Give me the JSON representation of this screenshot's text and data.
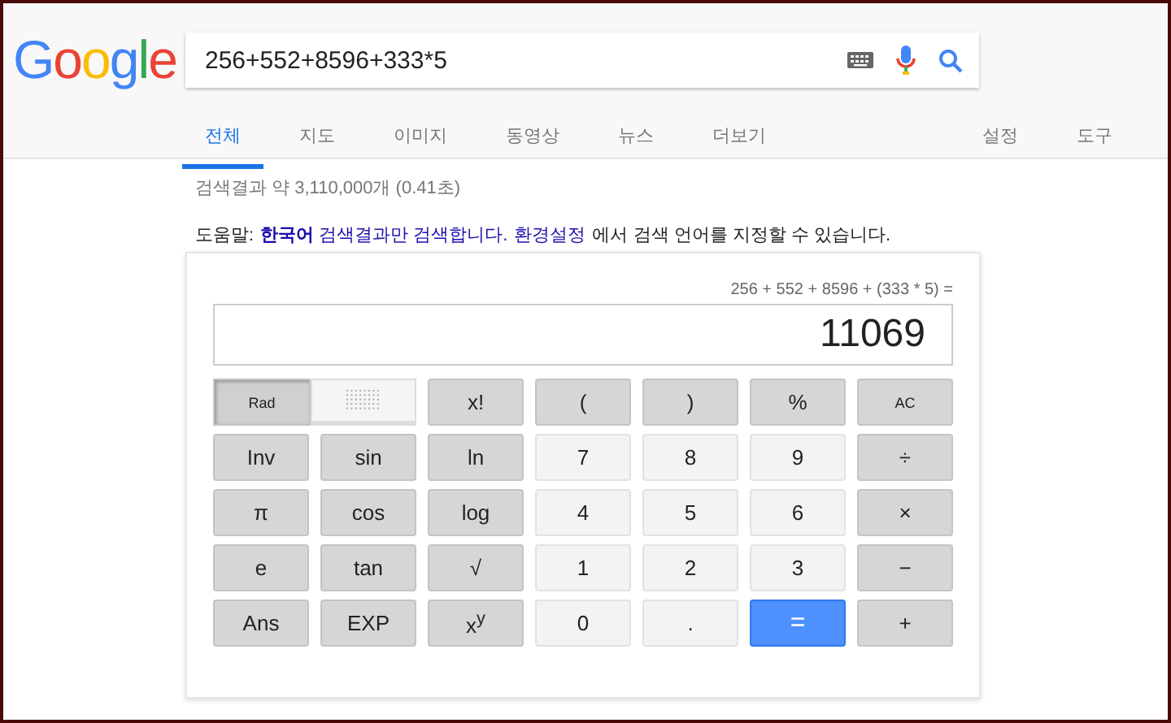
{
  "logo": [
    {
      "char": "G",
      "color": "#4285f4"
    },
    {
      "char": "o",
      "color": "#ea4335"
    },
    {
      "char": "o",
      "color": "#fbbc05"
    },
    {
      "char": "g",
      "color": "#4285f4"
    },
    {
      "char": "l",
      "color": "#34a853"
    },
    {
      "char": "e",
      "color": "#ea4335"
    }
  ],
  "search": {
    "value": "256+552+8596+333*5"
  },
  "tabs": [
    {
      "label": "전체",
      "selected": true
    },
    {
      "label": "지도",
      "selected": false
    },
    {
      "label": "이미지",
      "selected": false
    },
    {
      "label": "동영상",
      "selected": false
    },
    {
      "label": "뉴스",
      "selected": false
    },
    {
      "label": "더보기",
      "selected": false
    }
  ],
  "tools": [
    "설정",
    "도구"
  ],
  "result_stats": "검색결과 약 3,110,000개 (0.41초)",
  "help": [
    {
      "kind": "text",
      "text": "도움말:"
    },
    {
      "kind": "link",
      "text": "**한국어** 검색결과만 검색합니다."
    },
    {
      "kind": "link",
      "text": "환경설정"
    },
    {
      "kind": "text",
      "text": "에서 검색 언어를 지정할 수 있습니다."
    }
  ],
  "calculator": {
    "expression": "256 + 552 + 8596 + (333 * 5) =",
    "display": "11069",
    "angle_toggle": {
      "label": "Rad",
      "selected": true
    },
    "keys": [
      {
        "label": "x!",
        "kind": "func"
      },
      {
        "label": "(",
        "kind": "func"
      },
      {
        "label": ")",
        "kind": "func"
      },
      {
        "label": "%",
        "kind": "func"
      },
      {
        "label": "AC",
        "kind": "func"
      },
      {
        "label": "Inv",
        "kind": "func"
      },
      {
        "label": "sin",
        "kind": "func"
      },
      {
        "label": "ln",
        "kind": "func"
      },
      {
        "label": "7",
        "kind": "digit"
      },
      {
        "label": "8",
        "kind": "digit"
      },
      {
        "label": "9",
        "kind": "digit"
      },
      {
        "label": "÷",
        "kind": "func"
      },
      {
        "label": "π",
        "kind": "func"
      },
      {
        "label": "cos",
        "kind": "func"
      },
      {
        "label": "log",
        "kind": "func"
      },
      {
        "label": "4",
        "kind": "digit"
      },
      {
        "label": "5",
        "kind": "digit"
      },
      {
        "label": "6",
        "kind": "digit"
      },
      {
        "label": "×",
        "kind": "func"
      },
      {
        "label": "e",
        "kind": "func"
      },
      {
        "label": "tan",
        "kind": "func"
      },
      {
        "label": "√",
        "kind": "func"
      },
      {
        "label": "1",
        "kind": "digit"
      },
      {
        "label": "2",
        "kind": "digit"
      },
      {
        "label": "3",
        "kind": "digit"
      },
      {
        "label": "−",
        "kind": "func"
      },
      {
        "label": "Ans",
        "kind": "func"
      },
      {
        "label": "EXP",
        "kind": "func"
      },
      {
        "label": "x$^{y}$",
        "kind": "func"
      },
      {
        "label": "0",
        "kind": "digit"
      },
      {
        "label": ".",
        "kind": "digit"
      },
      {
        "label": "=",
        "kind": "equals"
      },
      {
        "label": "+",
        "kind": "func"
      }
    ]
  }
}
